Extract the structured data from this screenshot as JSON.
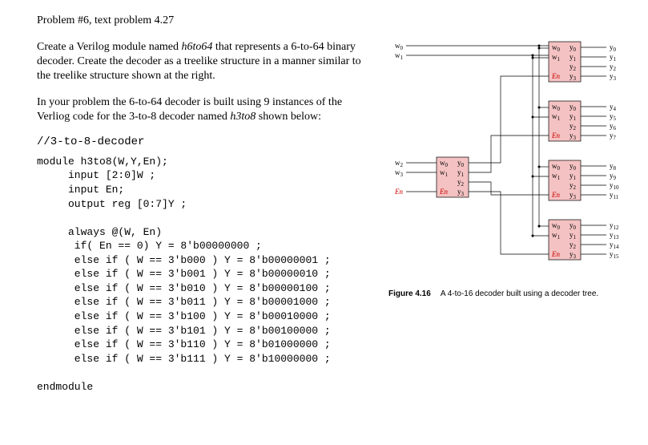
{
  "title": "Problem #6, text problem 4.27",
  "intro1_a": "Create a Verilog module named ",
  "intro1_modname": "h6to64",
  "intro1_b": " that represents a 6-to-64 binary decoder. Create the decoder as a treelike structure in a manner similar to the treelike structure shown at the right.",
  "intro2_a": "In your problem the 6-to-64 decoder is built using 9 instances of the Verliog code for the  3-to-8 decoder named ",
  "intro2_modname": "h3to8",
  "intro2_b": " shown below:",
  "comment": "//3-to-8-decoder",
  "code": "module h3to8(W,Y,En);\n     input [2:0]W ;\n     input En;\n     output reg [0:7]Y ;\n\n     always @(W, En)\n      if( En == 0) Y = 8'b00000000 ;\n      else if ( W == 3'b000 ) Y = 8'b00000001 ;\n      else if ( W == 3'b001 ) Y = 8'b00000010 ;\n      else if ( W == 3'b010 ) Y = 8'b00000100 ;\n      else if ( W == 3'b011 ) Y = 8'b00001000 ;\n      else if ( W == 3'b100 ) Y = 8'b00010000 ;\n      else if ( W == 3'b101 ) Y = 8'b00100000 ;\n      else if ( W == 3'b110 ) Y = 8'b01000000 ;\n      else if ( W == 3'b111 ) Y = 8'b10000000 ;\n\nendmodule",
  "fig_label": "Figure 4.16",
  "fig_caption": "A 4-to-16 decoder built using a decoder tree.",
  "diagram": {
    "left_inputs": [
      "w0",
      "w1",
      "w2",
      "w3",
      "En"
    ],
    "center_box": {
      "in": [
        "w0",
        "w1",
        "En"
      ],
      "out": [
        "y0",
        "y1",
        "y2",
        "y3"
      ]
    },
    "right_boxes": [
      {
        "in": [
          "w0",
          "w1",
          "En"
        ],
        "out": [
          "y0",
          "y1",
          "y2",
          "y3"
        ],
        "ext_out": [
          "y0",
          "y1",
          "y2",
          "y3"
        ]
      },
      {
        "in": [
          "w0",
          "w1",
          "En"
        ],
        "out": [
          "y0",
          "y1",
          "y2",
          "y3"
        ],
        "ext_out": [
          "y4",
          "y5",
          "y6",
          "y7"
        ]
      },
      {
        "in": [
          "w0",
          "w1",
          "En"
        ],
        "out": [
          "y0",
          "y1",
          "y2",
          "y3"
        ],
        "ext_out": [
          "y8",
          "y9",
          "y10",
          "y11"
        ]
      },
      {
        "in": [
          "w0",
          "w1",
          "En"
        ],
        "out": [
          "y0",
          "y1",
          "y2",
          "y3"
        ],
        "ext_out": [
          "y12",
          "y13",
          "y14",
          "y15"
        ]
      }
    ]
  }
}
